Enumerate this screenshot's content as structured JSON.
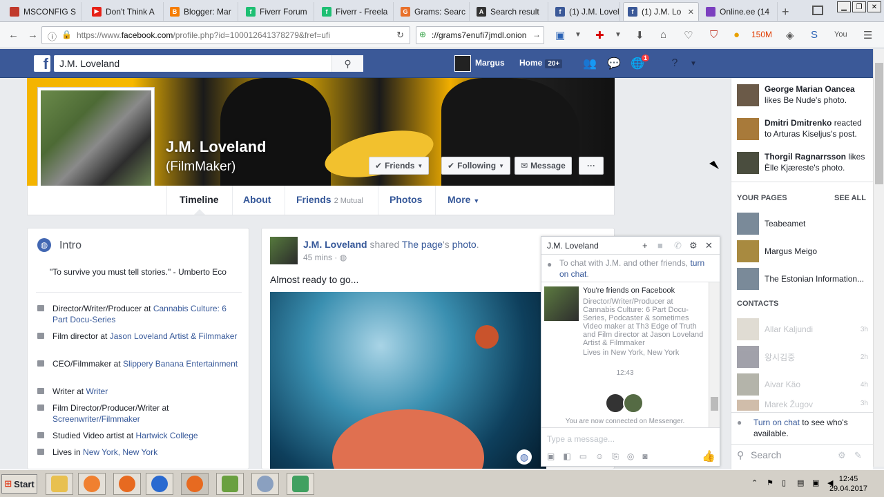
{
  "browser": {
    "tabs": [
      {
        "label": "MSCONFIG S",
        "icon_color": "#c0392b"
      },
      {
        "label": "Don't Think A",
        "icon_color": "#e62117"
      },
      {
        "label": "Blogger: Mar",
        "icon_color": "#f57d00"
      },
      {
        "label": "Fiverr Forum",
        "icon_color": "#1dbf73"
      },
      {
        "label": "Fiverr - Freela",
        "icon_color": "#1dbf73"
      },
      {
        "label": "Grams: Searc",
        "icon_color": "#e8702a"
      },
      {
        "label": "Search result",
        "icon_color": "#333333"
      },
      {
        "label": "(1) J.M. Lovel",
        "icon_color": "#3b5998"
      },
      {
        "label": "(1) J.M. Lo",
        "icon_color": "#3b5998"
      },
      {
        "label": "Online.ee (14",
        "icon_color": "#7b3fbf"
      }
    ],
    "url_prefix": "https://www.",
    "url_domain": "facebook.com",
    "url_path": "/profile.php?id=100012641378279&fref=ufi",
    "search_value": "://grams7enufi7jmdl.onion",
    "counter": "150M"
  },
  "fb": {
    "search_value": "J.M. Loveland",
    "user_name": "Margus",
    "home_label": "Home",
    "home_count": "20+",
    "notif_count": "1"
  },
  "profile": {
    "name": "J.M. Loveland",
    "subtitle": "(FilmMaker)",
    "btn_friends": "Friends",
    "btn_following": "Following",
    "btn_message": "Message",
    "btn_more_dots": "···",
    "tabs": {
      "timeline": "Timeline",
      "about": "About",
      "friends": "Friends",
      "mutual": "2 Mutual",
      "photos": "Photos",
      "more": "More"
    }
  },
  "intro": {
    "title": "Intro",
    "quote": "\"To survive you must tell stories.\" - Umberto Eco",
    "items": [
      {
        "text": "Director/Writer/Producer at ",
        "link": "Cannabis Culture: 6 Part Docu-Series"
      },
      {
        "text": "Film director at ",
        "link": "Jason Loveland Artist & Filmmaker"
      },
      {
        "text": "CEO/Filmmaker at ",
        "link": "Slippery Banana Entertainment"
      },
      {
        "text": "Writer at ",
        "link": "Writer"
      },
      {
        "text": "Film Director/Producer/Writer at ",
        "link": "Screenwriter/Filmmaker"
      },
      {
        "text": "Studied Video artist at ",
        "link": "Hartwick College"
      },
      {
        "text": "Lives in ",
        "link": "New York, New York"
      }
    ]
  },
  "post": {
    "author": "J.M. Loveland",
    "shared": "shared",
    "page": "The page",
    "possessive": "'s",
    "photo": "photo",
    "time": "45 mins",
    "text": "Almost ready to go..."
  },
  "chat": {
    "title": "J.M. Loveland",
    "info_text": "To chat with J.M. and other friends,",
    "info_link": "turn on chat",
    "card_title": "You're friends on Facebook",
    "card_desc": "Director/Writer/Producer at Cannabis Culture: 6 Part Docu-Series, Podcaster & sometimes Video maker at Th3 Edge of Truth and Film director at Jason Loveland Artist & Filmmaker",
    "card_loc": "Lives in New York, New York",
    "time": "12:43",
    "connected": "You are now connected on Messenger.",
    "input_placeholder": "Type a message..."
  },
  "sidebar": {
    "ticker": [
      {
        "name": "George Marian Oancea",
        "action": " likes Be Nude's photo."
      },
      {
        "name": "Dmitri Dmitrenko",
        "action": " reacted to Arturas Kiseljus's post."
      },
      {
        "name": "Thorgil Ragnarrsson",
        "action": " likes Èlle Kjæreste's photo."
      }
    ],
    "pages_header": "YOUR PAGES",
    "see_all": "SEE ALL",
    "pages": [
      "Teabeamet",
      "Margus Meigo",
      "The Estonian Information..."
    ],
    "contacts_header": "CONTACTS",
    "contacts": [
      {
        "name": "Allar Kaljundi",
        "time": "3h"
      },
      {
        "name": "왕시김중",
        "time": "2h"
      },
      {
        "name": "Aivar Käo",
        "time": "4h"
      },
      {
        "name": "Marek Žugov",
        "time": "3h"
      }
    ],
    "turn_on_link": "Turn on chat",
    "turn_on_text": " to see who's available.",
    "search_placeholder": "Search"
  },
  "taskbar": {
    "start": "Start",
    "time": "12:45",
    "date": "29.04.2017"
  }
}
